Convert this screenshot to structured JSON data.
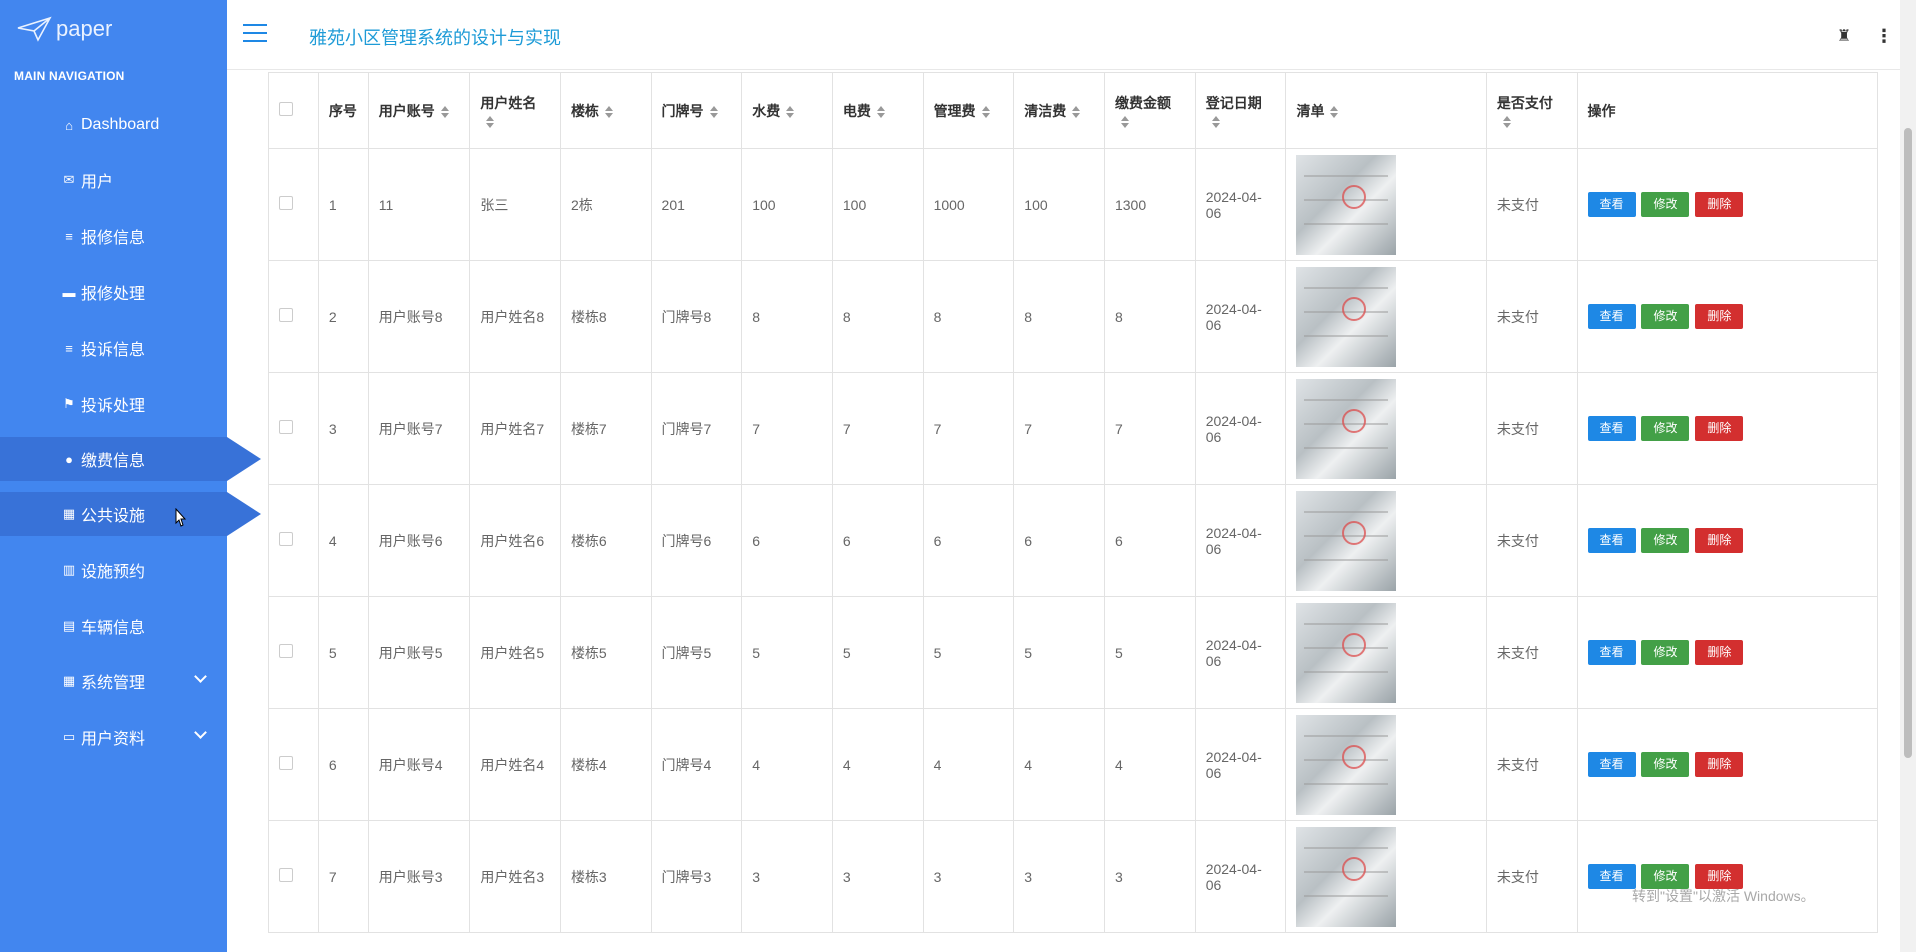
{
  "app": {
    "logo_text": "paper",
    "title": "雅苑小区管理系统的设计与实现"
  },
  "sidebar": {
    "header": "MAIN NAVIGATION",
    "items": [
      {
        "label": "Dashboard",
        "icon": "⌂"
      },
      {
        "label": "用户",
        "icon": "✉"
      },
      {
        "label": "报修信息",
        "icon": "≡"
      },
      {
        "label": "报修处理",
        "icon": "▬"
      },
      {
        "label": "投诉信息",
        "icon": "≡"
      },
      {
        "label": "投诉处理",
        "icon": "⚑"
      },
      {
        "label": "缴费信息",
        "icon": "●"
      },
      {
        "label": "公共设施",
        "icon": "▦"
      },
      {
        "label": "设施预约",
        "icon": "▥"
      },
      {
        "label": "车辆信息",
        "icon": "▤"
      },
      {
        "label": "系统管理",
        "icon": "▦"
      },
      {
        "label": "用户资料",
        "icon": "▭"
      }
    ]
  },
  "table": {
    "headers": [
      "序号",
      "用户账号",
      "用户姓名",
      "楼栋",
      "门牌号",
      "水费",
      "电费",
      "管理费",
      "清洁费",
      "缴费金额",
      "登记日期",
      "清单",
      "是否支付",
      "操作"
    ],
    "rows": [
      {
        "no": "1",
        "account": "11",
        "name": "张三",
        "building": "2栋",
        "door": "201",
        "water": "100",
        "power": "100",
        "manage": "1000",
        "clean": "100",
        "amount": "1300",
        "date": "2024-04-06",
        "paid": "未支付"
      },
      {
        "no": "2",
        "account": "用户账号8",
        "name": "用户姓名8",
        "building": "楼栋8",
        "door": "门牌号8",
        "water": "8",
        "power": "8",
        "manage": "8",
        "clean": "8",
        "amount": "8",
        "date": "2024-04-06",
        "paid": "未支付"
      },
      {
        "no": "3",
        "account": "用户账号7",
        "name": "用户姓名7",
        "building": "楼栋7",
        "door": "门牌号7",
        "water": "7",
        "power": "7",
        "manage": "7",
        "clean": "7",
        "amount": "7",
        "date": "2024-04-06",
        "paid": "未支付"
      },
      {
        "no": "4",
        "account": "用户账号6",
        "name": "用户姓名6",
        "building": "楼栋6",
        "door": "门牌号6",
        "water": "6",
        "power": "6",
        "manage": "6",
        "clean": "6",
        "amount": "6",
        "date": "2024-04-06",
        "paid": "未支付"
      },
      {
        "no": "5",
        "account": "用户账号5",
        "name": "用户姓名5",
        "building": "楼栋5",
        "door": "门牌号5",
        "water": "5",
        "power": "5",
        "manage": "5",
        "clean": "5",
        "amount": "5",
        "date": "2024-04-06",
        "paid": "未支付"
      },
      {
        "no": "6",
        "account": "用户账号4",
        "name": "用户姓名4",
        "building": "楼栋4",
        "door": "门牌号4",
        "water": "4",
        "power": "4",
        "manage": "4",
        "clean": "4",
        "amount": "4",
        "date": "2024-04-06",
        "paid": "未支付"
      },
      {
        "no": "7",
        "account": "用户账号3",
        "name": "用户姓名3",
        "building": "楼栋3",
        "door": "门牌号3",
        "water": "3",
        "power": "3",
        "manage": "3",
        "clean": "3",
        "amount": "3",
        "date": "2024-04-06",
        "paid": "未支付"
      }
    ]
  },
  "actions": {
    "view": "查看",
    "edit": "修改",
    "delete": "删除"
  },
  "watermark": "转到\"设置\"以激活 Windows。",
  "colors": {
    "sidebar": "#4286ef",
    "sidebar_active": "#3872d8",
    "accent": "#1e9bd7",
    "view": "#1e88e5",
    "edit": "#43a047",
    "delete": "#d32f2f"
  }
}
